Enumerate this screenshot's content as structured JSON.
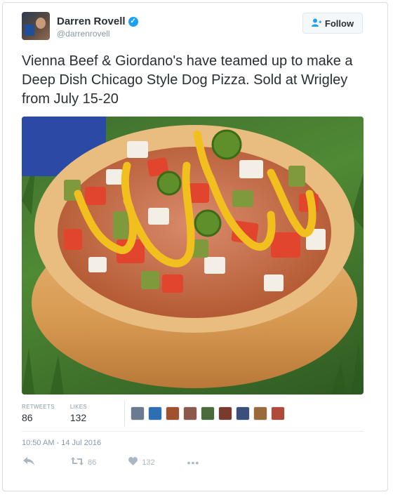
{
  "author": {
    "display_name": "Darren Rovell",
    "handle": "@darrenrovell",
    "verified_icon": "verified-badge-icon"
  },
  "follow": {
    "label": "Follow",
    "icon": "add-user-icon"
  },
  "tweet": {
    "text": "Vienna Beef & Giordano's have teamed up to make a Deep Dish Chicago Style Dog Pizza. Sold at Wrigley from July 15-20"
  },
  "media": {
    "alt": "deep-dish-hot-dog-pizza-photo"
  },
  "stats": {
    "retweets_label": "RETWEETS",
    "retweets_value": "86",
    "likes_label": "LIKES",
    "likes_value": "132"
  },
  "likers": [
    {
      "color": "#6b7a8f"
    },
    {
      "color": "#2d6fb3"
    },
    {
      "color": "#a0522d"
    },
    {
      "color": "#8b5a4a"
    },
    {
      "color": "#4a6b3a"
    },
    {
      "color": "#7a3b2e"
    },
    {
      "color": "#3a4f7a"
    },
    {
      "color": "#9a6a3a"
    },
    {
      "color": "#b04a3a"
    }
  ],
  "timestamp": "10:50 AM - 14 Jul 2016",
  "actions": {
    "reply_icon": "reply-icon",
    "retweet_icon": "retweet-icon",
    "retweet_count": "86",
    "like_icon": "heart-icon",
    "like_count": "132",
    "more_icon": "more-dots-icon"
  },
  "colors": {
    "accent": "#1da1f2",
    "muted": "#8899a6",
    "text": "#292f33"
  }
}
